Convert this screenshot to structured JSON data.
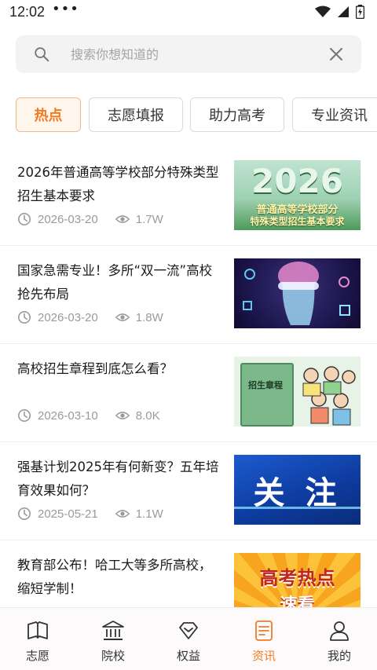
{
  "status_bar": {
    "time": "12:02",
    "dots": "•••"
  },
  "search": {
    "placeholder": "搜索你想知道的",
    "value": ""
  },
  "tabs": [
    {
      "label": "热点",
      "active": true
    },
    {
      "label": "志愿填报",
      "active": false
    },
    {
      "label": "助力高考",
      "active": false
    },
    {
      "label": "专业资讯",
      "active": false
    }
  ],
  "news": [
    {
      "title": "2026年普通高等学校部分特殊类型招生基本要求",
      "date": "2026-03-20",
      "views": "1.7W",
      "thumb_text": "2026",
      "thumb_sub1": "普通高等学校部分",
      "thumb_sub2": "特殊类型招生基本要求"
    },
    {
      "title": "国家急需专业！多所“双一流”高校抢先布局",
      "date": "2026-03-20",
      "views": "1.8W"
    },
    {
      "title": "高校招生章程到底怎么看？",
      "date": "2026-03-10",
      "views": "8.0K",
      "thumb_text": "招生章程"
    },
    {
      "title": "强基计划2025年有何新变？五年培育效果如何？",
      "date": "2025-05-21",
      "views": "1.1W",
      "thumb_text": "关 注"
    },
    {
      "title": "教育部公布！哈工大等多所高校，缩短学制！",
      "date": "",
      "views": "",
      "thumb_text": "高考热点",
      "thumb_sub1": "速看"
    }
  ],
  "bottom_nav": [
    {
      "label": "志愿",
      "icon": "book-icon",
      "active": false
    },
    {
      "label": "院校",
      "icon": "school-icon",
      "active": false
    },
    {
      "label": "权益",
      "icon": "diamond-icon",
      "active": false
    },
    {
      "label": "资讯",
      "icon": "news-icon",
      "active": true
    },
    {
      "label": "我的",
      "icon": "user-icon",
      "active": false
    }
  ],
  "colors": {
    "accent": "#f27b22",
    "meta": "#9a9a9a",
    "search_bg": "#f3f3f3"
  }
}
